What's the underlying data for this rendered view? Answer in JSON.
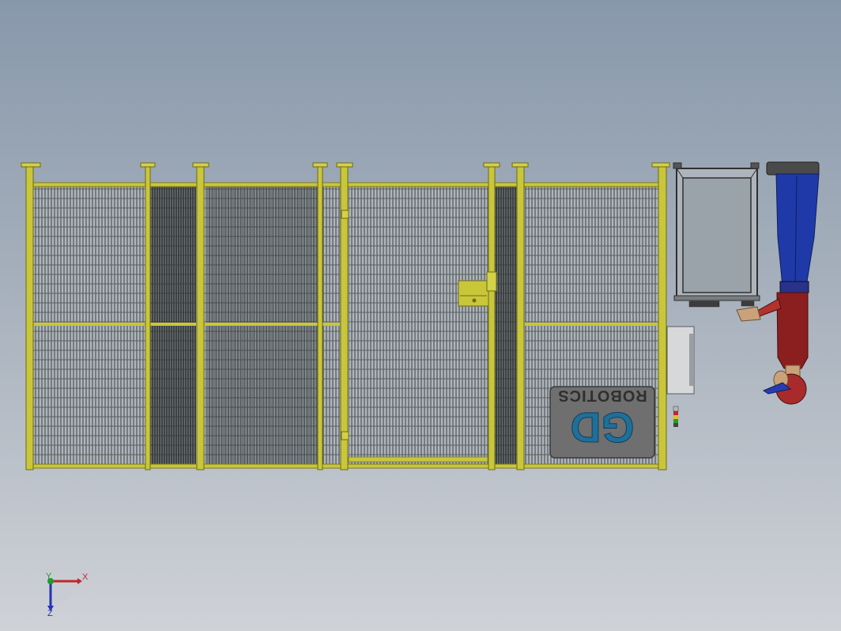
{
  "viewport": {
    "background_top": "#8898ab",
    "background_bottom": "#cfd2d7"
  },
  "fence": {
    "frame_color": "#c9c63a",
    "frame_dark": "#7d7a1c",
    "mesh_color": "#3f4440",
    "panel_count": 5
  },
  "logo_sign": {
    "text": "ROBOTICS",
    "letters": "GD",
    "text_color": "#2f2f2f",
    "logo_color": "#1f6f9a",
    "plate_color": "#6f6f6f",
    "orientation": "upside-down"
  },
  "door_lock": {
    "color": "#c9c63a"
  },
  "cart": {
    "frame_color": "#4a4a4a"
  },
  "human_figure": {
    "shirt_color": "#8b1e1e",
    "pants_color": "#1f3aa8",
    "skin_color": "#c9a27a",
    "cap_color": "#2a3bb0"
  },
  "triad": {
    "x_label": "X",
    "y_label": "Y",
    "z_label": "Z",
    "x_color": "#c0282c",
    "y_color": "#1f9a2f",
    "z_color": "#2432b4"
  }
}
